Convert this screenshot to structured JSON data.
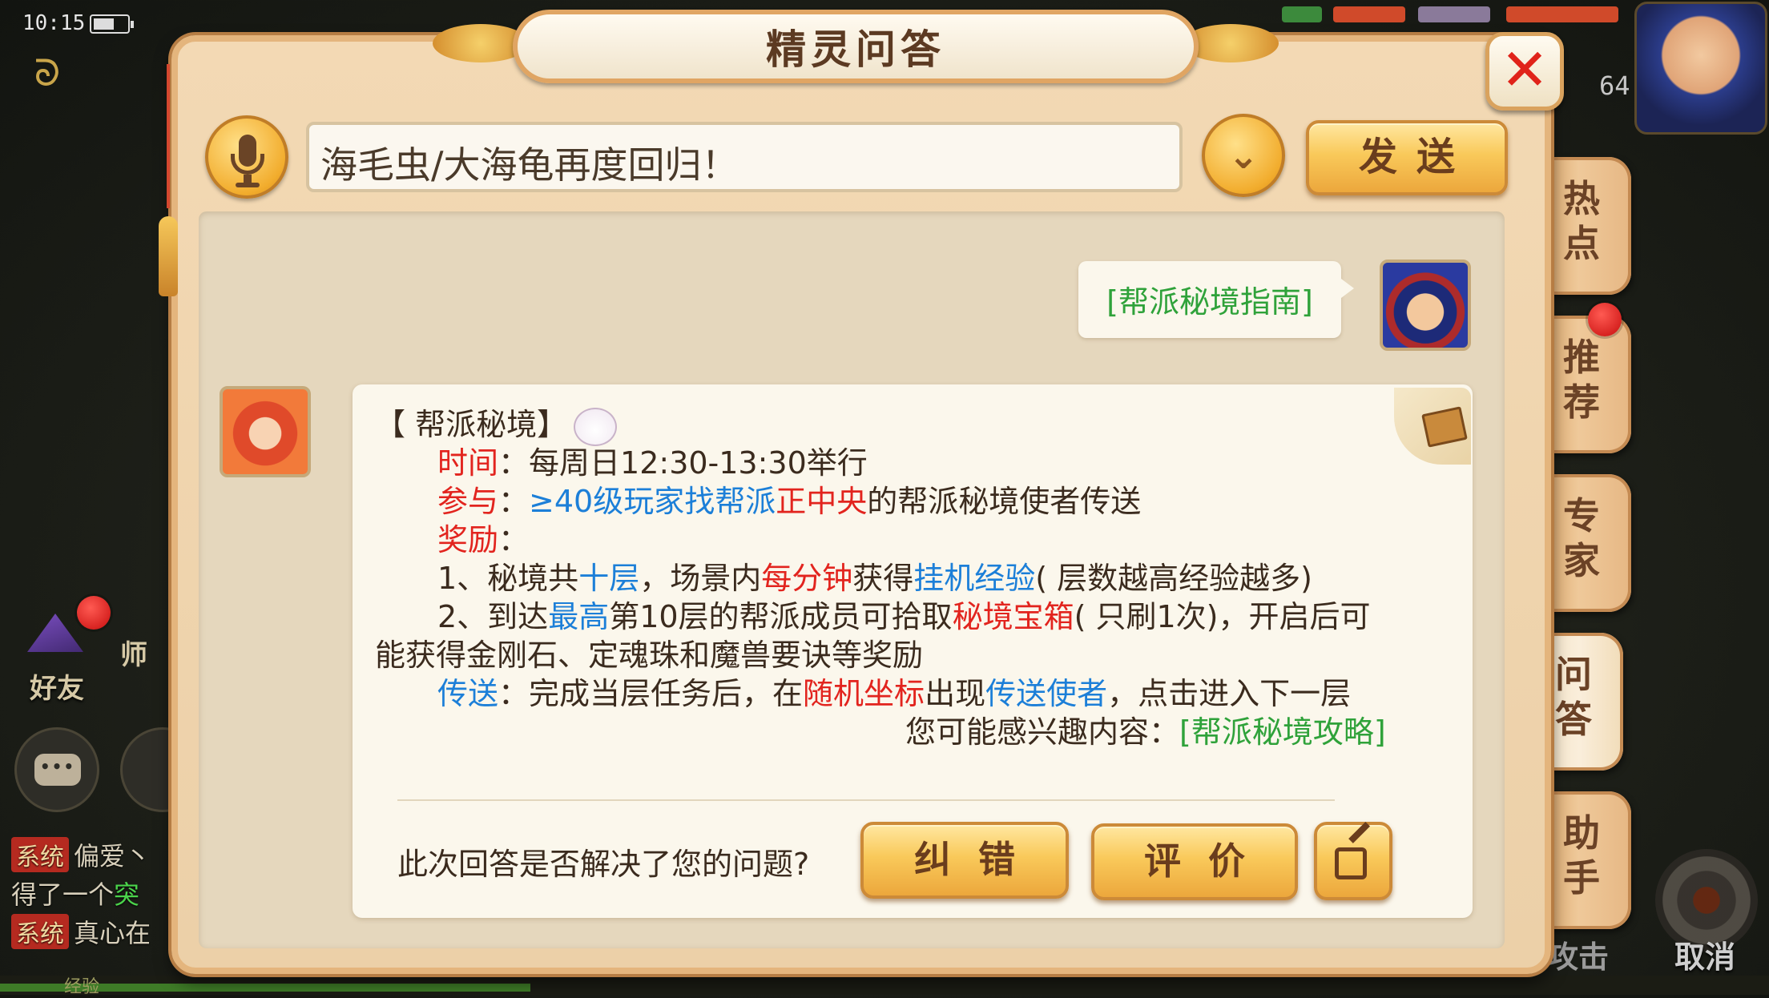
{
  "status_bar": {
    "time": "10:15"
  },
  "panel": {
    "title": "精灵问答",
    "close_label": "✕"
  },
  "input": {
    "value": "海毛虫/大海龟再度回归！",
    "send_label": "发送"
  },
  "side_tabs": [
    {
      "label": "热点",
      "active": false
    },
    {
      "label": "推荐",
      "active": false
    },
    {
      "label": "专家",
      "active": false
    },
    {
      "label": "问答",
      "active": true
    },
    {
      "label": "助手",
      "active": false
    }
  ],
  "user_message": "[帮派秘境指南]",
  "answer": {
    "heading": "【 帮派秘境】",
    "time_label": "时间",
    "time_value": "每周日12:30-13:30举行",
    "join_label": "参与",
    "join_blue": "≥40级玩家找帮派",
    "join_red": "正中央",
    "join_tail": "的帮派秘境使者传送",
    "reward_label": "奖励",
    "r1_a": "1、秘境共",
    "r1_b": "十层",
    "r1_c": "，场景内",
    "r1_d": "每分钟",
    "r1_e": "获得",
    "r1_f": "挂机经验",
    "r1_g": "( 层数越高经验越多)",
    "r2_a": "2、到达",
    "r2_b": "最高",
    "r2_c": "第10层的帮派成员可拾取",
    "r2_d": "秘境宝箱",
    "r2_e": "( 只刷1次)，开启后可",
    "r2_line2": "能获得金刚石、定魂珠和魔兽要诀等奖励",
    "tp_label": "传送",
    "tp_a": "完成当层任务后，在",
    "tp_b": "随机坐标",
    "tp_c": "出现",
    "tp_d": "传送使者",
    "tp_e": "，点击进入下一层",
    "interest_prefix": "您可能感兴趣内容：",
    "interest_link": "[帮派秘境攻略]"
  },
  "feedback": {
    "question": "此次回答是否解决了您的问题?",
    "fix_label": "纠错",
    "rate_label": "评价"
  },
  "background_hud": {
    "friend_label": "好友",
    "master_label": "师",
    "level": "64",
    "attack_label": "攻击",
    "cancel_label": "取消",
    "exp_label": "经验",
    "chat": [
      {
        "tag": "系统",
        "text": "偏爱丶"
      },
      {
        "tag": "",
        "text": "得了一个",
        "green": "突"
      },
      {
        "tag": "系统",
        "text": "真心在"
      }
    ]
  }
}
